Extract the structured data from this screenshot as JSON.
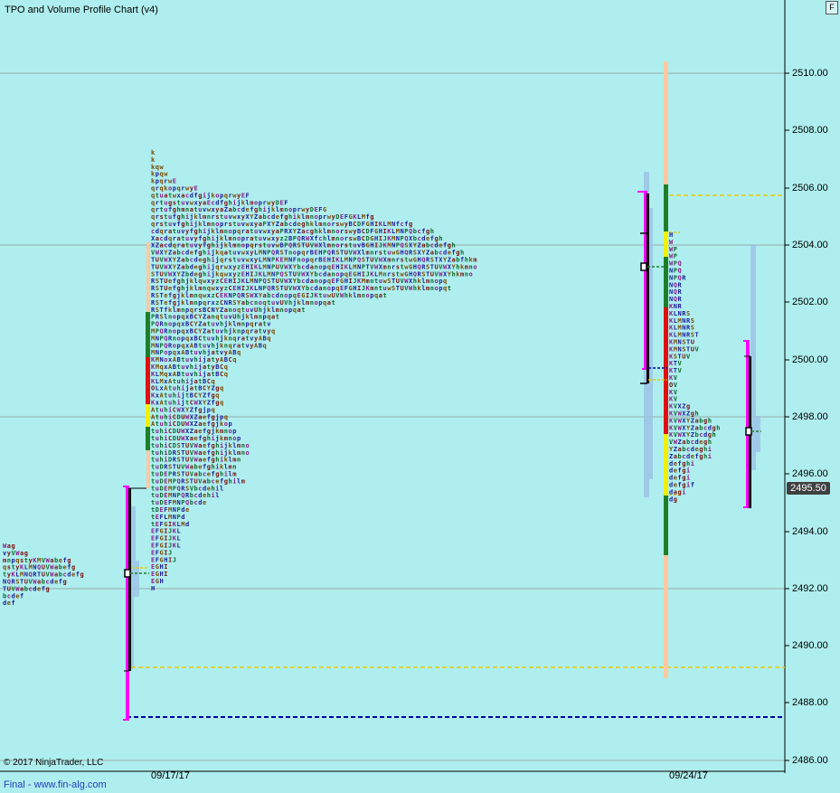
{
  "window": {
    "title": "TPO and Volume Profile Chart (v4)",
    "copyright": "© 2017 NinjaTrader, LLC",
    "footer": "Final - www.fin-alg.com",
    "f_button": "F"
  },
  "price_axis": {
    "ticks": [
      "2510.00",
      "2508.00",
      "2506.00",
      "2504.00",
      "2502.00",
      "2500.00",
      "2498.00",
      "2496.00",
      "2494.00",
      "2492.00",
      "2490.00",
      "2488.00",
      "2486.00"
    ],
    "current_price": "2495.50"
  },
  "time_axis": {
    "labels": [
      "09/17/17",
      "09/24/17"
    ]
  },
  "colors": {
    "background": "#afeeee",
    "value_area_green": "#1e7f2a",
    "value_area_red": "#e01010",
    "value_area_yellow": "#f0f000",
    "range_bar": "#ffc8a0",
    "profile_bracket": "#ff00ff",
    "poc_line": "#e8c800",
    "vpoc_line": "#0000a0"
  },
  "profiles": {
    "prior_left": {
      "letters": [
        "Wag",
        "vyVWag",
        "mnpqstyKMVWabefg",
        "qstyKLMNQUVWabefg",
        "tyKLMNQRTUVWabcdefg",
        "NQRSTUVWabcdefg",
        "TUVWabcdefg",
        "bcdef",
        "def"
      ]
    },
    "week1": {
      "letters": [
        "k",
        "k",
        "kqw",
        "kpqw",
        "kpqrwE",
        "qrqkopqrwyE",
        "qtuatwxacdfgijkopqrwyEF",
        "qrtugstuvwxyaEcdfghijklmoprwyDEF",
        "qrtufghmnatuvwxyaZabcdefghijklmnoprwyDEFG",
        "qrstufghijklmnrstuvwxyXYZabcdefghiklmnoprwyDEFGKLMfg",
        "qrstuvfghijklmnoprstuvwxyaPXYZabcdeghklmnorswyBCDFGHIKLMNfcfg",
        "cdqratuvyfghijklmnopqratuvwxyaPRXYZacghklmnorswyBCDFGHIKLMNPQbcfgh",
        "Xacdqratuvyfghijklmnopratuvwxyz2BPQRWXfchlmnorswBCDGHIJKMNPQXbcdefgh",
        "XZacdqratuvyfghijklmnopqrstuvwBPQRSTUVWXlmnorstuvBGHIJKMNPQSXYZabcdefgh",
        "VWXYZabcdefghijkqatuvwxyLMNPQRSTnopqrBEHPQRSTUVWXlmnrstuwGHQRSXYZabcdefgh",
        "TUVWXYZabcdeghijqrstuvwxyLMNPKEMNFnopqrBEHIKLMNPQSTUVWXmnrstwGHQRSTXYZabfhkm",
        "TUVWXYZabdeghijqrwxyzEHIKLMNPUVWXYbcdanopqEHIKLMNPTVWXmnrstwGHQRSTUVWXYhkmno",
        "STUVWXYZbdeghijkqwxyzEHIJKLMNPQSTUVWXYbcdanopqEGHIJKLMnrstwGHQRSTUVWXYhkmno",
        "RSTUefghjklqwxyzCEHIJKLMNPQSTUVWXYbcdanopqEFGHIJKMmntuwSTUVWXhklmnopq",
        "RSTUefghjklmnqwxyzCEHIJKLNPQRSTUVWXYbcdanopqEFGHIJKmntuwSTUVWhklmnopqt",
        "RSTefgjklmnqwxzCEKNPQRSWXYabcdnopqEGIJKtuwUVWhklmnopqat",
        "RSTefgjklmnpqrxzCNRSYabcnoqtuvUVhjklmnopqat",
        "RSTfklmnpqrsBCNYZanoqtuvUhjklmnopqat",
        "PRSlnopqxBCYZanqtuvUhjklmnpqat",
        "PQRnopqxBCYZatuvhjklmnpqratv",
        "MPQRnopqxBCYZatuvhjknpqratvyq",
        "MNPQRnopqxBCtuvhjknqratvyABq",
        "MNPQRopqxABtuvhjknqratvyABq",
        "MNPopqxABtuvhjatvyABq",
        "KMNoxABtuvhijatyABCq",
        "KMqxABtuvhijatyBCq",
        "KLMqxABtuvhijatBCq",
        "KLMxAtuhijatBCq",
        "OLxAtuhijatBCYZgq",
        "KxAtuhijtBCYZfgq",
        "KxAtuhijtCWXYZfgq",
        "AtuhiCWXYZfgjpq",
        "AtuhiCDUWXZaefgjpq",
        "AtuhiCDUWXZaefgjkop",
        "tuhiCDUWXZaefgjkmnop",
        "tuhiCDUWXaefghijkmnop",
        "tuhiCDSTUVWaefghijklmno",
        "tuhiDRSTUVWaefghijklmno",
        "tuhiDRSTUVWaefghiklmn",
        "tuDRSTUVWabefghiklmn",
        "tuDEPRSTUVabcefghilm",
        "tuDEMPQRSTUVabcefghilm",
        "tuDEMPQRSVbcdehil",
        "tuDEMNPQRbcdehil",
        "tuDEFMNPQbcde",
        "tDEFMNPde",
        "tEFLMNPd",
        "tEFGIKLMd",
        "EFGIJKL",
        "EFGIJKL",
        "EFGIJKL",
        "EFGIJ",
        "EFGHIJ",
        "EGHI",
        "EGHI",
        "EGH",
        "H"
      ]
    },
    "week2": {
      "letters": [
        "H",
        "W",
        "WP",
        "WP",
        "WPQ",
        "NPQ",
        "NPQR",
        "NQR",
        "NQR",
        "NQR",
        "KNR",
        "KLNRS",
        "KLMNRS",
        "KLMNRS",
        "KLMNRST",
        "KMNSTU",
        "KMNSTUV",
        "KSTUV",
        "KTV",
        "KTV",
        "KV",
        "OV",
        "KV",
        "KV",
        "KVXZg",
        "KVWXZgh",
        "KVWXYZabgh",
        "KVWXYZabcdgh",
        "KVWXYZbcdgh",
        "VWZabcdegh",
        "YZabcdeghi",
        "Zabcdefghi",
        "defghi",
        "defgi",
        "defgi",
        "defgif",
        "dagi",
        "dg"
      ]
    }
  }
}
